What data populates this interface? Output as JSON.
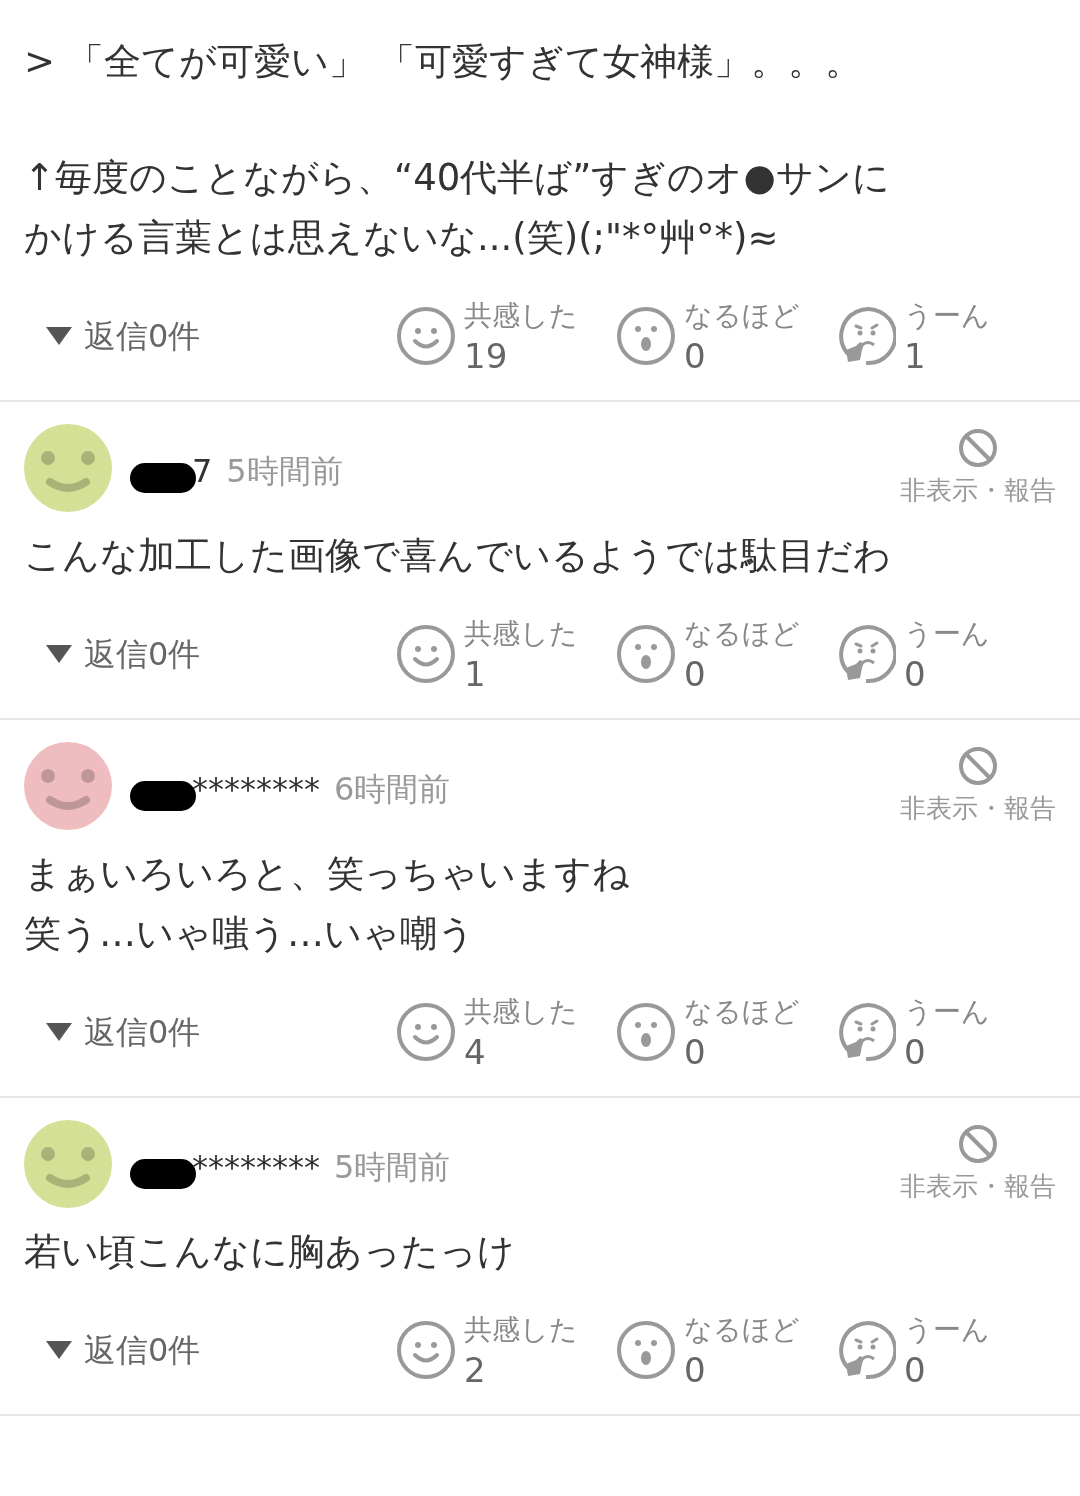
{
  "comments": [
    {
      "body": [
        [
          "> 「全てが可愛い」 「可愛すぎて女神様」。。。"
        ],
        [
          "↑毎度のことながら、“40代半ば”すぎのオ●サンに",
          "かける言葉とは思えないな...(笑)(;\"*°艸°*)≈"
        ]
      ],
      "replies": "返信0件",
      "reactions": [
        {
          "kind": "empathy",
          "label": "共感した",
          "count": "19"
        },
        {
          "kind": "surprise",
          "label": "なるほど",
          "count": "0"
        },
        {
          "kind": "doubt",
          "label": "うーん",
          "count": "1"
        }
      ]
    },
    {
      "author": {
        "name": "7",
        "color": "#d4e096"
      },
      "time": "5時間前",
      "hide": "非表示・報告",
      "body": [
        [
          "こんな加工した画像で喜んでいるようでは駄目だわ"
        ]
      ],
      "replies": "返信0件",
      "reactions": [
        {
          "kind": "empathy",
          "label": "共感した",
          "count": "1"
        },
        {
          "kind": "surprise",
          "label": "なるほど",
          "count": "0"
        },
        {
          "kind": "doubt",
          "label": "うーん",
          "count": "0"
        }
      ]
    },
    {
      "author": {
        "name": "********",
        "color": "#efbcc0"
      },
      "time": "6時間前",
      "hide": "非表示・報告",
      "body": [
        [
          "まぁいろいろと、笑っちゃいますね",
          "笑う…いゃ嗤う…いゃ嘲う"
        ]
      ],
      "replies": "返信0件",
      "reactions": [
        {
          "kind": "empathy",
          "label": "共感した",
          "count": "4"
        },
        {
          "kind": "surprise",
          "label": "なるほど",
          "count": "0"
        },
        {
          "kind": "doubt",
          "label": "うーん",
          "count": "0"
        }
      ]
    },
    {
      "author": {
        "name": "********",
        "color": "#d4e096"
      },
      "time": "5時間前",
      "hide": "非表示・報告",
      "body": [
        [
          "若い頃こんなに胸あったっけ"
        ]
      ],
      "replies": "返信0件",
      "reactions": [
        {
          "kind": "empathy",
          "label": "共感した",
          "count": "2"
        },
        {
          "kind": "surprise",
          "label": "なるほど",
          "count": "0"
        },
        {
          "kind": "doubt",
          "label": "うーん",
          "count": "0"
        }
      ]
    }
  ]
}
